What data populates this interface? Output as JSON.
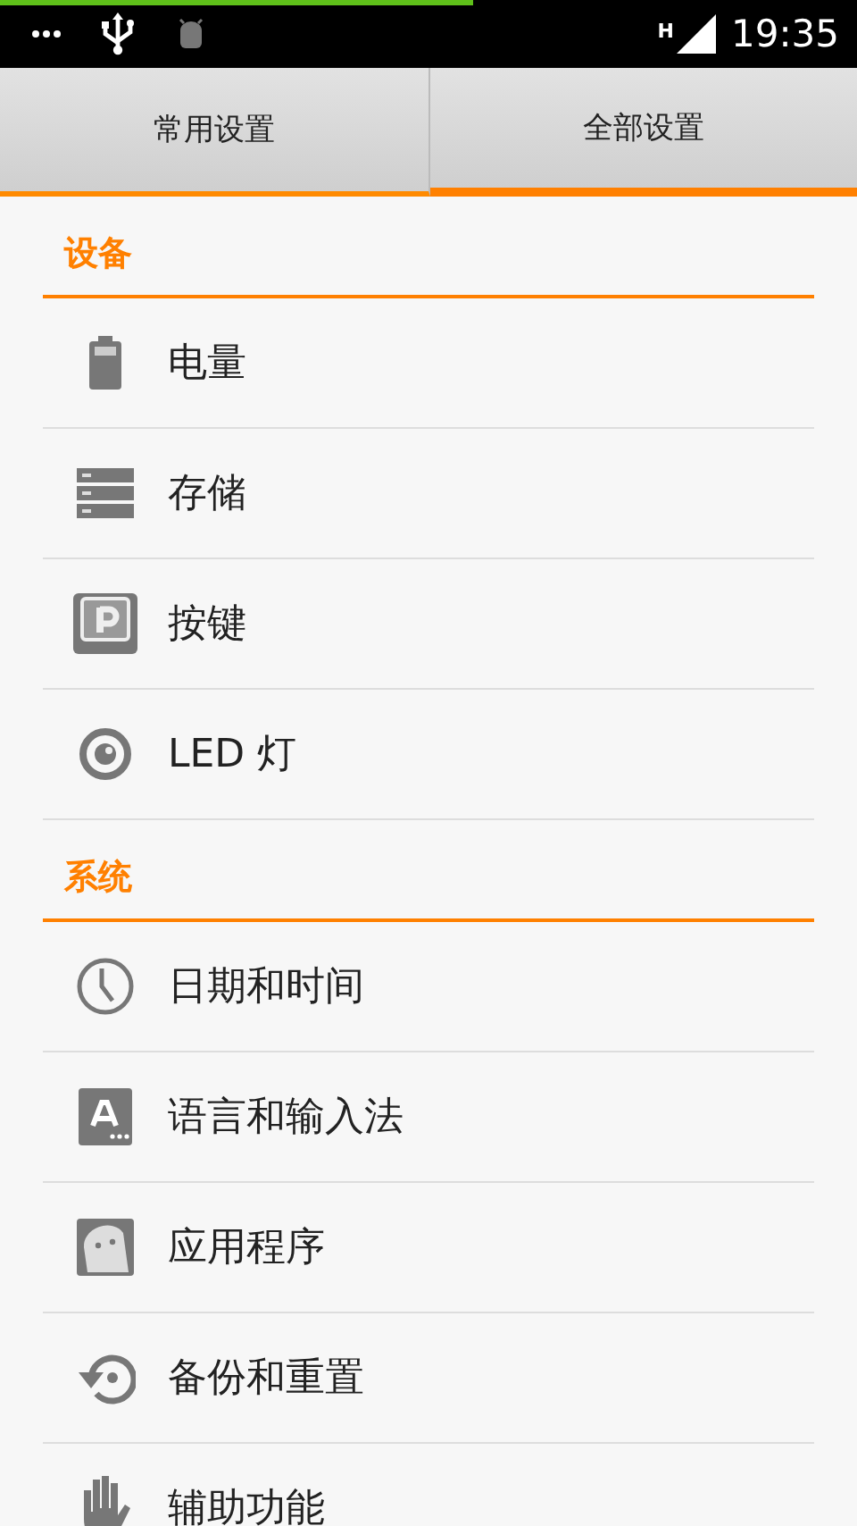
{
  "status_bar": {
    "network": "H",
    "time": "19:35"
  },
  "tabs": [
    {
      "label": "常用设置",
      "selected": false
    },
    {
      "label": "全部设置",
      "selected": true
    }
  ],
  "sections": [
    {
      "title": "设备",
      "items": [
        {
          "label": "电量",
          "kind": "battery"
        },
        {
          "label": "存储",
          "kind": "storage"
        },
        {
          "label": "按键",
          "kind": "key"
        },
        {
          "label": "LED 灯",
          "kind": "led"
        }
      ]
    },
    {
      "title": "系统",
      "items": [
        {
          "label": "日期和时间",
          "kind": "clock"
        },
        {
          "label": "语言和输入法",
          "kind": "language"
        },
        {
          "label": "应用程序",
          "kind": "apps"
        },
        {
          "label": "备份和重置",
          "kind": "backup"
        },
        {
          "label": "辅助功能",
          "kind": "hand"
        }
      ]
    }
  ]
}
